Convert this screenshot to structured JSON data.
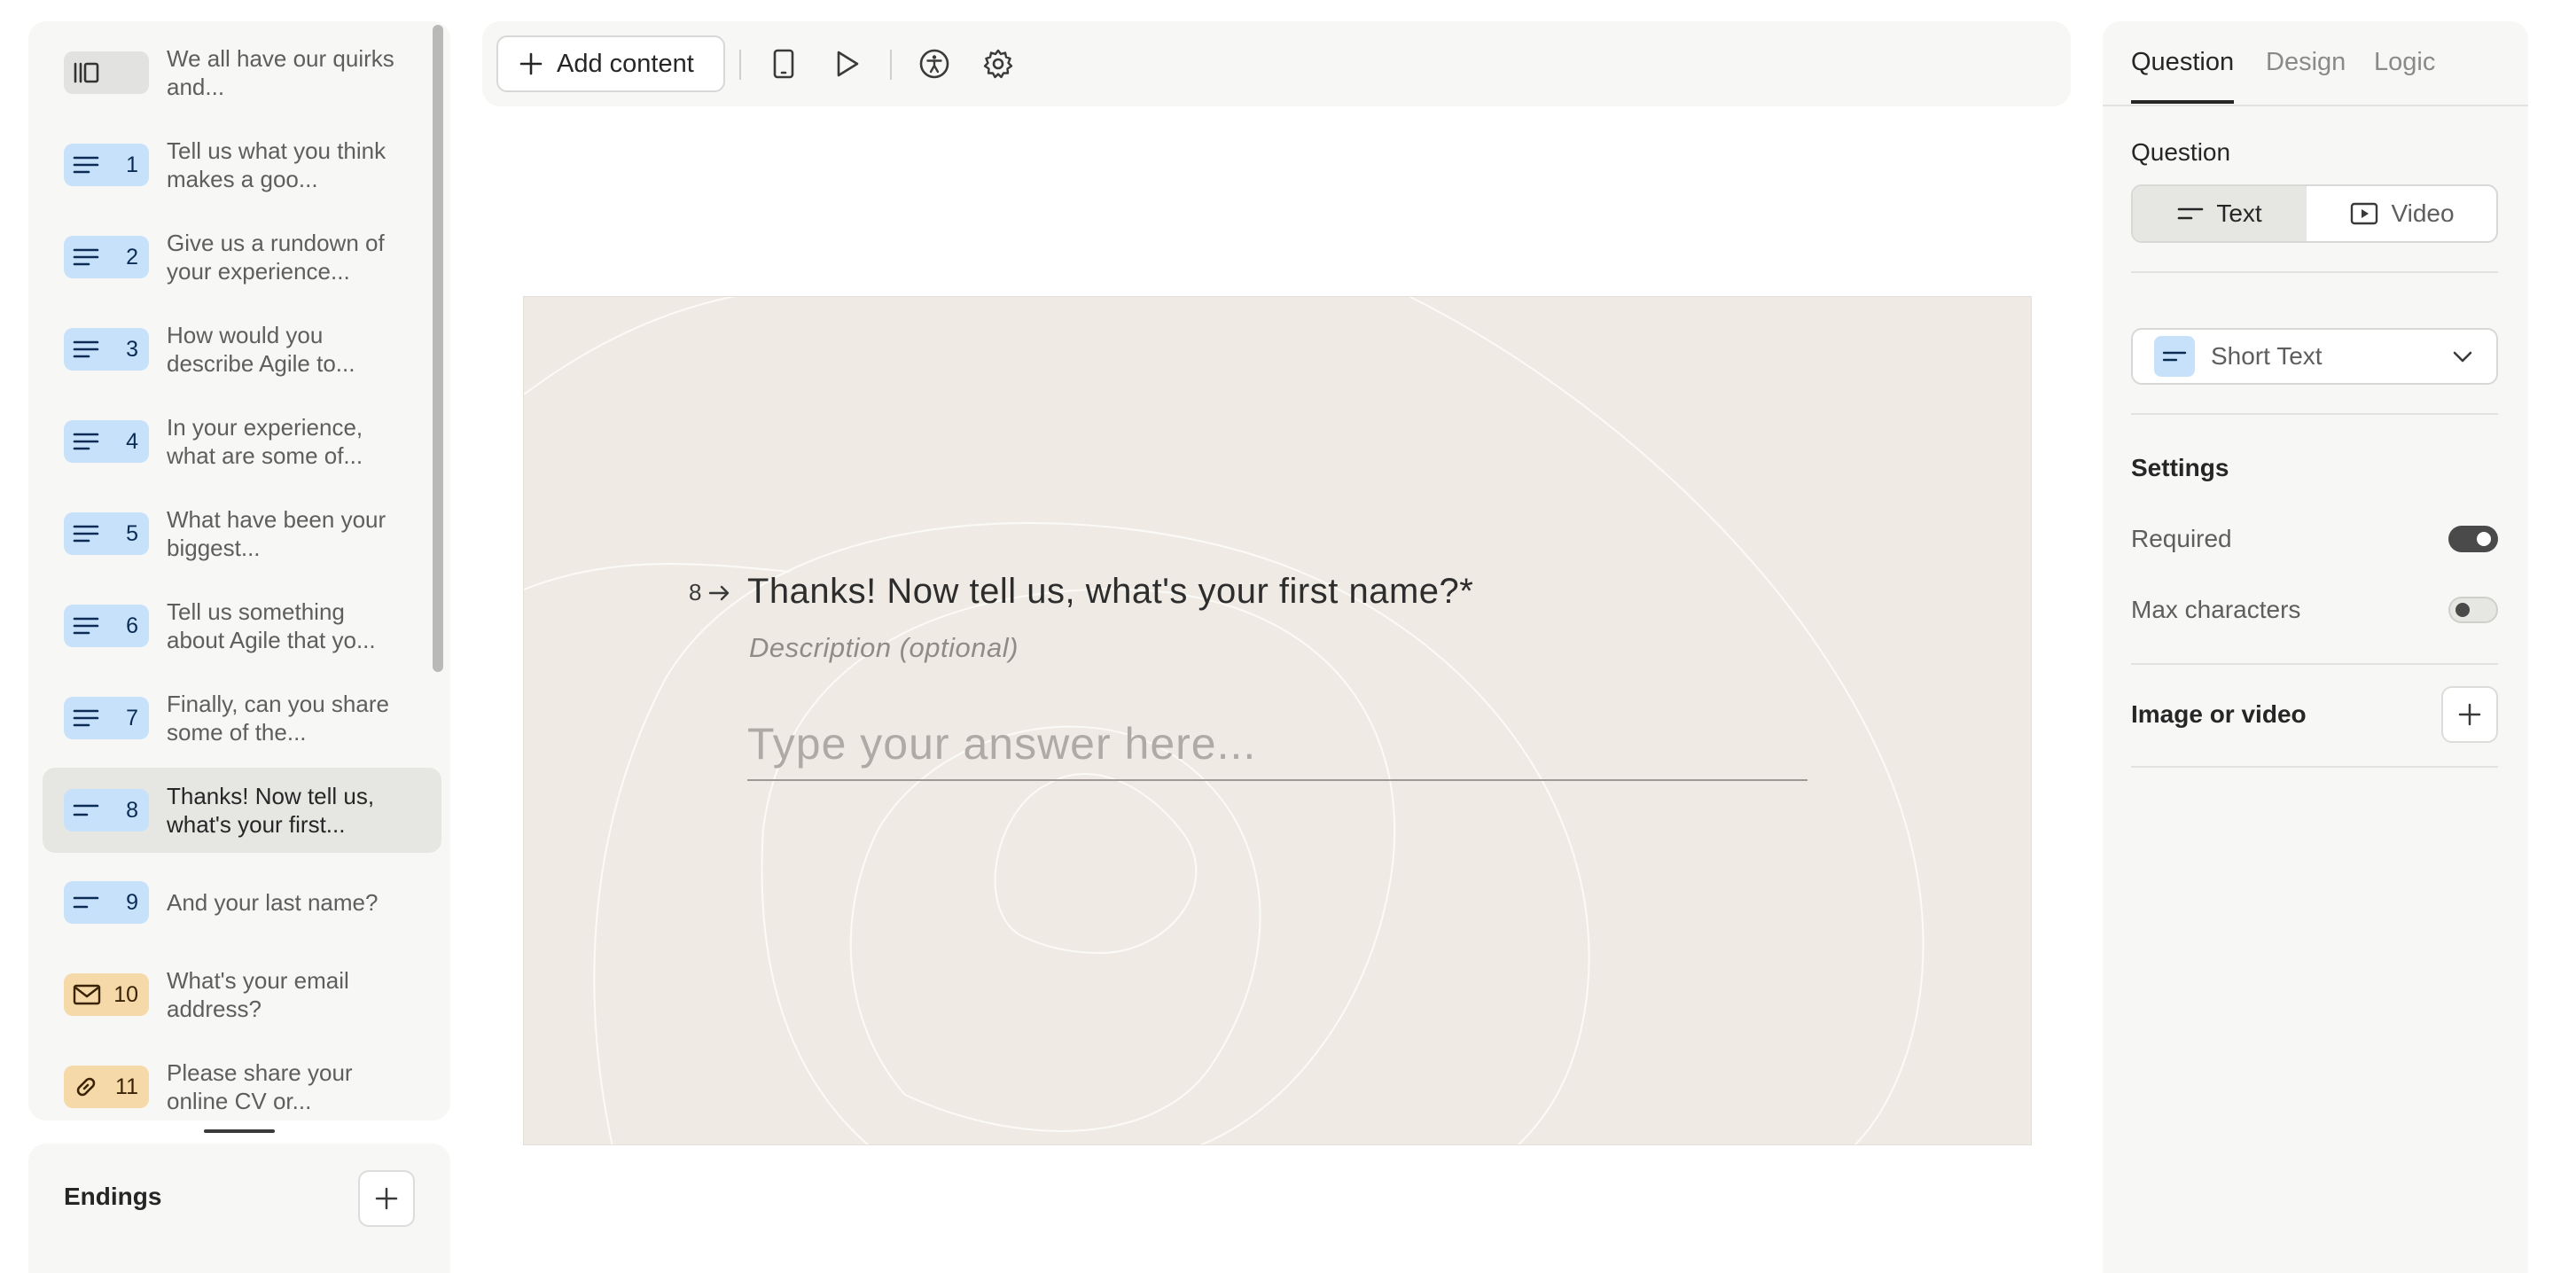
{
  "sidebar": {
    "items": [
      {
        "num": "",
        "label": "We all have our quirks and...",
        "color": "gray",
        "icon": "welcome-screen-icon"
      },
      {
        "num": "1",
        "label": "Tell us what you think makes a goo...",
        "color": "blue",
        "icon": "long-text-icon"
      },
      {
        "num": "2",
        "label": "Give us a rundown of your experience...",
        "color": "blue",
        "icon": "long-text-icon"
      },
      {
        "num": "3",
        "label": "How would you describe Agile to...",
        "color": "blue",
        "icon": "long-text-icon"
      },
      {
        "num": "4",
        "label": "In your experience, what are some of...",
        "color": "blue",
        "icon": "long-text-icon"
      },
      {
        "num": "5",
        "label": "What have been your biggest...",
        "color": "blue",
        "icon": "long-text-icon"
      },
      {
        "num": "6",
        "label": "Tell us something about Agile that yo...",
        "color": "blue",
        "icon": "long-text-icon"
      },
      {
        "num": "7",
        "label": "Finally, can you share some of the...",
        "color": "blue",
        "icon": "long-text-icon"
      },
      {
        "num": "8",
        "label": "Thanks! Now tell us, what's your first...",
        "color": "blue",
        "icon": "short-text-icon",
        "selected": true
      },
      {
        "num": "9",
        "label": "And your last name?",
        "color": "blue",
        "icon": "short-text-icon"
      },
      {
        "num": "10",
        "label": "What's your email address?",
        "color": "orange",
        "icon": "email-icon"
      },
      {
        "num": "11",
        "label": "Please share your online CV or...",
        "color": "orange",
        "icon": "link-icon"
      }
    ]
  },
  "endings": {
    "title": "Endings"
  },
  "toolbar": {
    "add_content_label": "Add content"
  },
  "canvas": {
    "question_number": "8",
    "question_title": "Thanks! Now tell us, what's your first name?*",
    "description_placeholder": "Description (optional)",
    "answer_placeholder": "Type your answer here..."
  },
  "right_panel": {
    "tabs": [
      "Question",
      "Design",
      "Logic"
    ],
    "question_label": "Question",
    "format_text": "Text",
    "format_video": "Video",
    "question_type": "Short Text",
    "settings_label": "Settings",
    "required_label": "Required",
    "required_on": true,
    "max_chars_label": "Max characters",
    "max_chars_on": false,
    "image_video_label": "Image or video"
  },
  "colors": {
    "badge_blue": "#c8e1fb",
    "badge_orange": "#f5d9a8",
    "canvas_bg": "#efebe4"
  }
}
